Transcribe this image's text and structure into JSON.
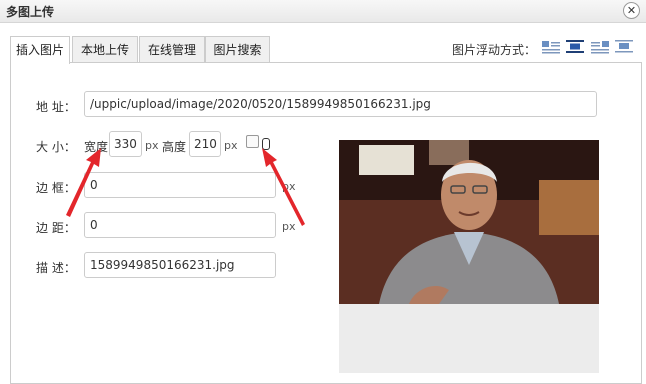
{
  "dialog": {
    "title": "多图上传",
    "close_glyph": "✕"
  },
  "tabs": [
    {
      "label": "插入图片",
      "active": true
    },
    {
      "label": "本地上传",
      "active": false
    },
    {
      "label": "在线管理",
      "active": false
    },
    {
      "label": "图片搜索",
      "active": false
    }
  ],
  "float": {
    "label": "图片浮动方式：",
    "icons": [
      "float-left-icon",
      "float-none-icon",
      "float-center-icon",
      "float-right-icon"
    ],
    "active_index": 1
  },
  "form": {
    "address_label": "地 址：",
    "address_value": "/uppic/upload/image/2020/0520/1589949850166231.jpg",
    "size_label": "大 小：",
    "width_label": "宽度",
    "width_value": "330",
    "px": "px",
    "height_label": "高度",
    "height_value": "210",
    "border_label": "边 框：",
    "border_value": "0",
    "margin_label": "边 距：",
    "margin_value": "0",
    "desc_label": "描 述：",
    "desc_value": "1589949850166231.jpg"
  },
  "colors": {
    "arrow": "#e3262b",
    "preview_bg": "#ececec"
  }
}
